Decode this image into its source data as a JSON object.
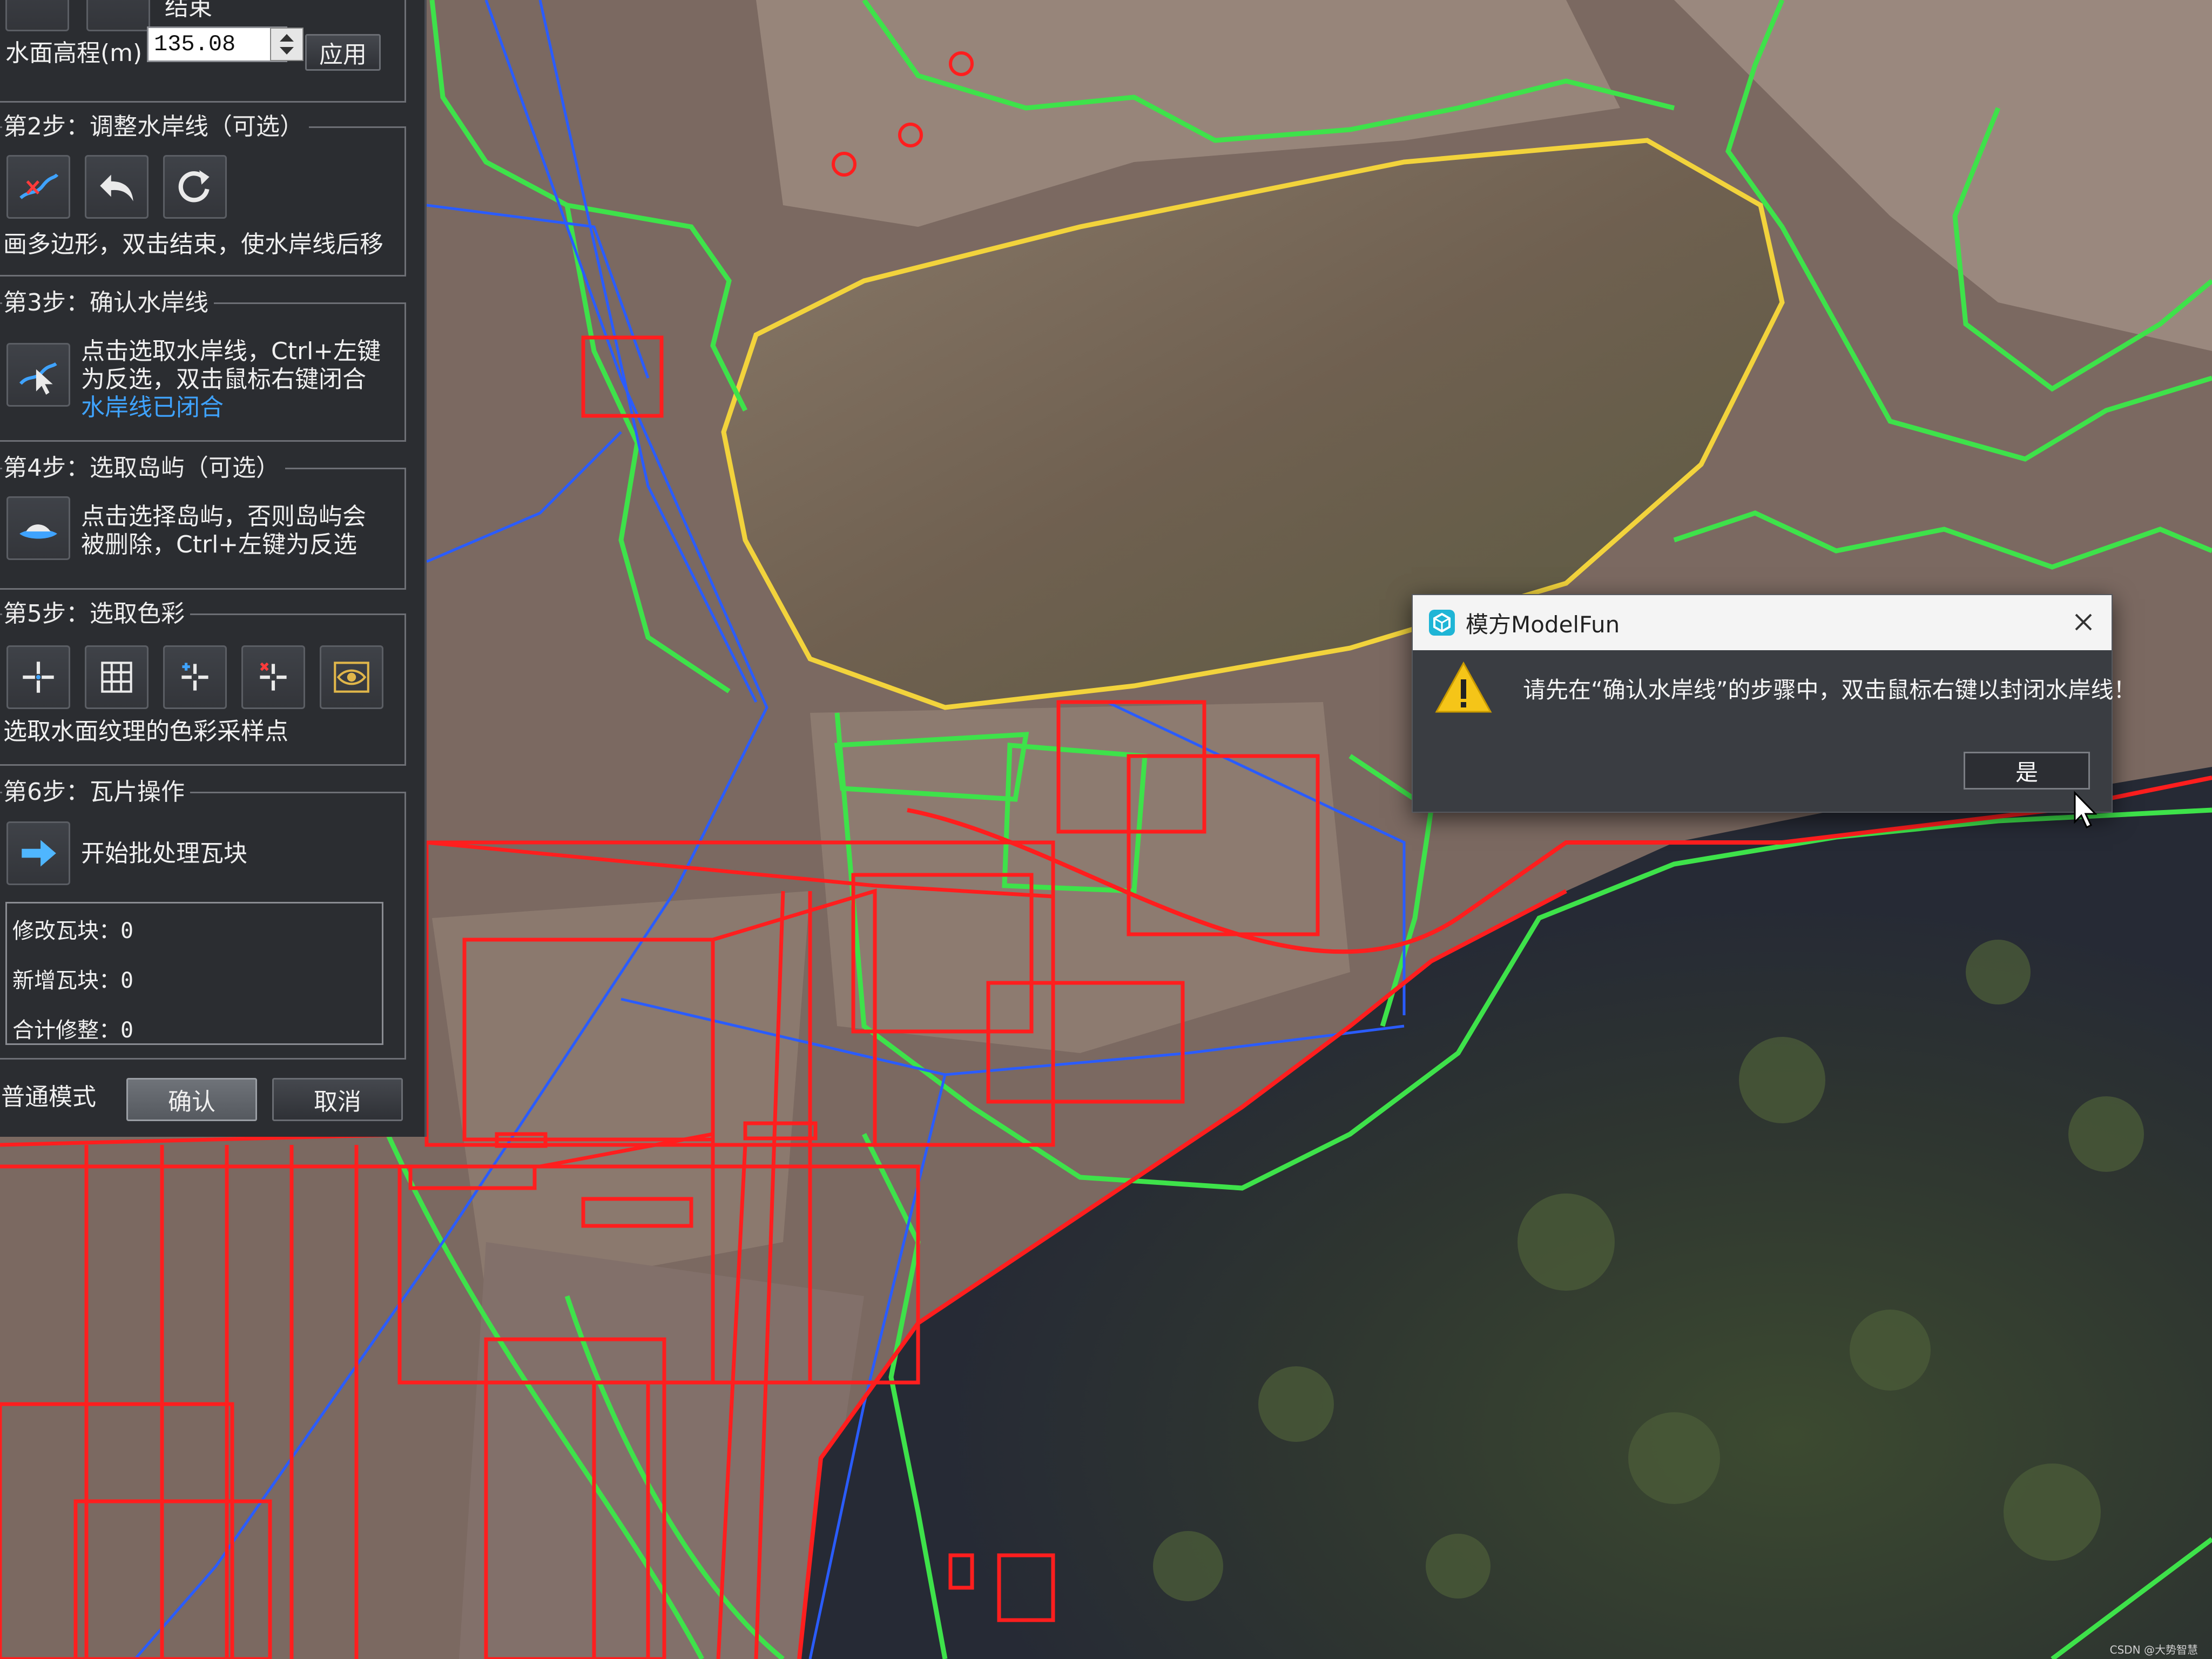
{
  "panel": {
    "step1_end_label": "结束",
    "water_level_label": "水面高程(m)",
    "water_level_value": "135.08",
    "apply_label": "应用",
    "step2": {
      "title": "第2步：调整水岸线（可选）",
      "icons": [
        "draw-shoreline-icon",
        "undo-icon",
        "refresh-icon"
      ],
      "desc": "画多边形，双击结束，使水岸线后移"
    },
    "step3": {
      "title": "第3步：确认水岸线",
      "icon": "select-shoreline-icon",
      "desc_line1": "点击选取水岸线，Ctrl+左键",
      "desc_line2": "为反选，双击鼠标右键闭合",
      "status": "水岸线已闭合"
    },
    "step4": {
      "title": "第4步：选取岛屿（可选）",
      "icon": "island-icon",
      "desc_line1": "点击选择岛屿，否则岛屿会",
      "desc_line2": "被删除，Ctrl+左键为反选"
    },
    "step5": {
      "title": "第5步：选取色彩",
      "icons": [
        "crosshair-icon",
        "grid-icon",
        "crosshair-add-icon",
        "crosshair-remove-icon",
        "eye-icon"
      ],
      "desc": "选取水面纹理的色彩采样点"
    },
    "step6": {
      "title": "第6步：瓦片操作",
      "icon": "arrow-right-icon",
      "action": "开始批处理瓦块"
    },
    "stats": {
      "modified": "修改瓦块：0",
      "added": "新增瓦块：0",
      "total": "合计修整：0"
    },
    "mode_label": "普通模式",
    "confirm_label": "确认",
    "cancel_label": "取消"
  },
  "dialog": {
    "title": "模方ModelFun",
    "message": "请先在“确认水岸线”的步骤中，双击鼠标右键以封闭水岸线！",
    "ok_label": "是",
    "icon": "warning-icon"
  },
  "watermark": "CSDN @大势智慧",
  "colors": {
    "panel_bg": "#2b2d31",
    "shoreline_green": "#3ee24a",
    "selection_yellow": "#f2d33c",
    "tile_red": "#ff1e1e",
    "route_blue": "#2a5cff",
    "link_blue": "#3fa3ff"
  }
}
